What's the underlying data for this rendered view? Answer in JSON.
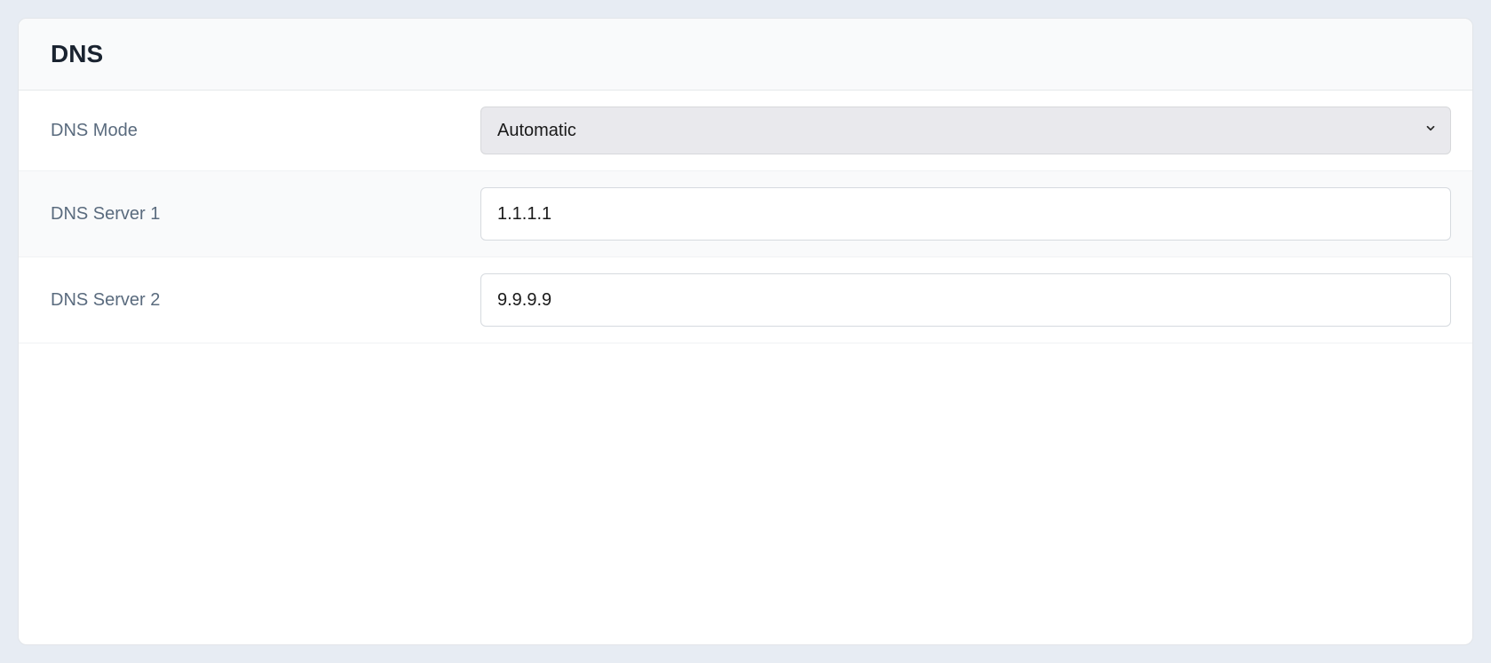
{
  "card": {
    "title": "DNS"
  },
  "form": {
    "dns_mode": {
      "label": "DNS Mode",
      "value": "Automatic"
    },
    "dns_server_1": {
      "label": "DNS Server 1",
      "value": "1.1.1.1"
    },
    "dns_server_2": {
      "label": "DNS Server 2",
      "value": "9.9.9.9"
    }
  }
}
